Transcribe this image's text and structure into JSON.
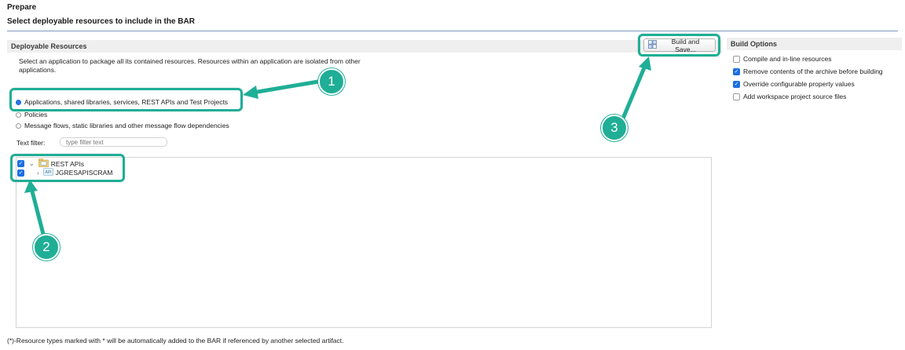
{
  "header": {
    "title": "Prepare",
    "subtitle": "Select deployable resources to include in the BAR"
  },
  "deployable": {
    "heading": "Deployable Resources",
    "description": "Select an application to package all its contained resources. Resources within an application are isolated from other applications.",
    "radios": [
      {
        "label": "Applications, shared libraries, services, REST APIs and Test Projects",
        "selected": true
      },
      {
        "label": "Policies",
        "selected": false
      },
      {
        "label": "Message flows, static libraries and other message flow dependencies",
        "selected": false
      }
    ],
    "filter": {
      "label": "Text filter:",
      "placeholder": "type filter text"
    },
    "tree": [
      {
        "label": "REST APIs",
        "checked": true,
        "expanded": true,
        "icon": "folder-icon"
      },
      {
        "label": "JGRESAPISCRAM",
        "checked": true,
        "expanded": false,
        "icon": "api-icon"
      }
    ]
  },
  "build": {
    "button_label": "Build and Save..."
  },
  "options": {
    "heading": "Build Options",
    "items": [
      {
        "label": "Compile and in-line resources",
        "checked": false
      },
      {
        "label": "Remove contents of the archive before building",
        "checked": true
      },
      {
        "label": "Override configurable property values",
        "checked": true
      },
      {
        "label": "Add workspace project source files",
        "checked": false
      }
    ]
  },
  "footnote": "(*)-Resource types marked with * will be automatically added to the BAR if referenced by another selected artifact.",
  "annotations": {
    "badge1": "1",
    "badge2": "2",
    "badge3": "3"
  },
  "colors": {
    "accent": "#1fae96",
    "selection": "#1b6fe0"
  }
}
